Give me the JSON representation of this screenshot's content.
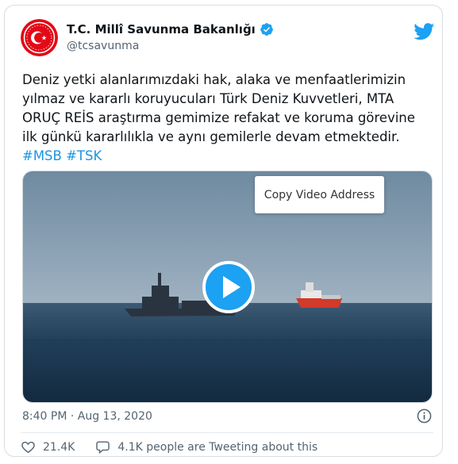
{
  "tweet": {
    "display_name": "T.C. Millî Savunma Bakanlığı",
    "handle": "@tcsavunma",
    "text_lines": [
      "Deniz yetki alanlarımızdaki hak, alaka ve menfaatlerimizin",
      "yılmaz ve kararlı koruyucuları Türk Deniz Kuvvetleri, MTA",
      "ORUÇ REİS araştırma gemimize refakat ve koruma görevine",
      "ilk günkü kararlılıkla ve aynı gemilerle devam etmektedir."
    ],
    "hashtags": [
      "#MSB",
      "#TSK"
    ],
    "timestamp": "8:40 PM · Aug 13, 2020",
    "likes": "21.4K",
    "tweeting_about": "4.1K people are Tweeting about this"
  },
  "media": {
    "context_menu_item": "Copy Video Address"
  },
  "icons": {
    "avatar": "msb-emblem-icon",
    "verified": "verified-badge-icon",
    "brand": "twitter-bird-icon",
    "play": "play-icon",
    "info": "info-icon",
    "like": "heart-icon",
    "comment": "speech-bubble-icon"
  },
  "colors": {
    "accent": "#1da1f2",
    "hashtag": "#1b95e0",
    "avatar_red": "#e30a17"
  }
}
